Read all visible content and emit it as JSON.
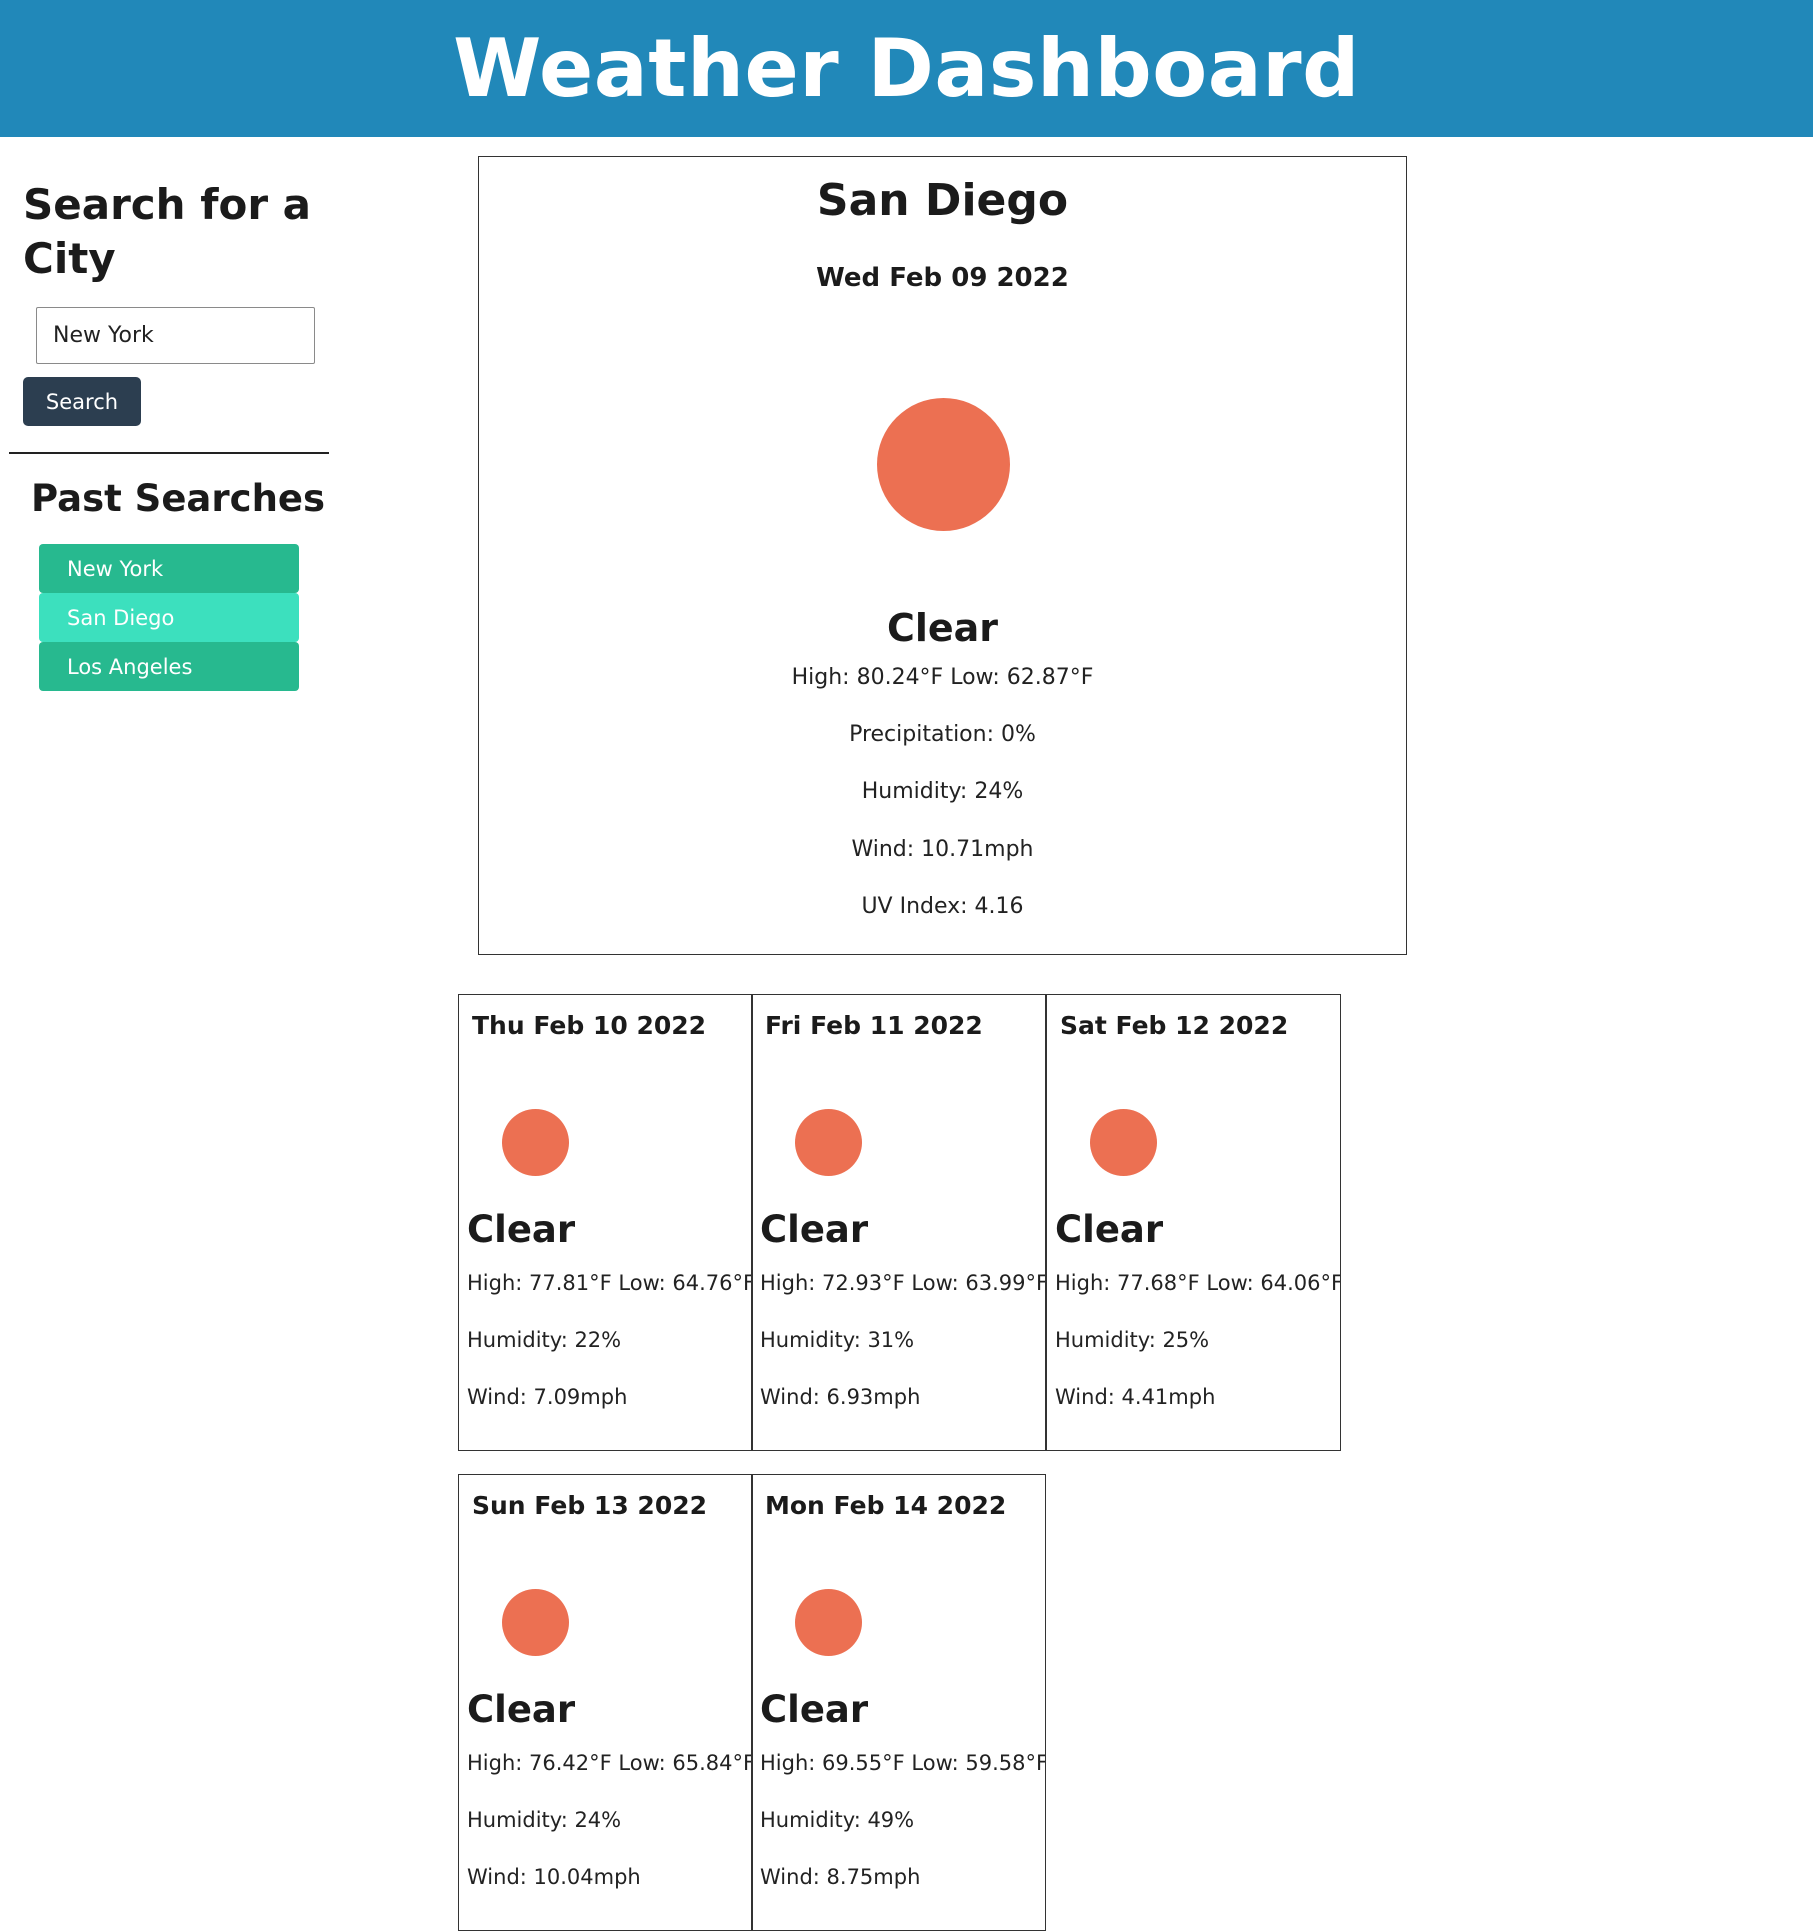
{
  "app": {
    "title": "Weather Dashboard"
  },
  "sidebar": {
    "search_title": "Search for a City",
    "search_input": {
      "value": "New York",
      "placeholder": ""
    },
    "search_button_label": "Search",
    "past_title": "Past Searches",
    "past_searches": [
      {
        "label": "New York",
        "color": "#27b98f"
      },
      {
        "label": "San Diego",
        "color": "#3ce0be"
      },
      {
        "label": "Los Angeles",
        "color": "#27b98f"
      }
    ]
  },
  "current": {
    "city": "San Diego",
    "date": "Wed Feb 09 2022",
    "icon": "sun-icon",
    "condition": "Clear",
    "high_low": "High: 80.24°F Low: 62.87°F",
    "precipitation": "Precipitation: 0%",
    "humidity": "Humidity: 24%",
    "wind": "Wind: 10.71mph",
    "uv_index": "UV Index: 4.16"
  },
  "forecast": [
    {
      "date": "Thu Feb 10 2022",
      "icon": "sun-icon",
      "condition": "Clear",
      "high_low": "High: 77.81°F Low: 64.76°F",
      "humidity": "Humidity: 22%",
      "wind": "Wind: 7.09mph"
    },
    {
      "date": "Fri Feb 11 2022",
      "icon": "sun-icon",
      "condition": "Clear",
      "high_low": "High: 72.93°F Low: 63.99°F",
      "humidity": "Humidity: 31%",
      "wind": "Wind: 6.93mph"
    },
    {
      "date": "Sat Feb 12 2022",
      "icon": "sun-icon",
      "condition": "Clear",
      "high_low": "High: 77.68°F Low: 64.06°F",
      "humidity": "Humidity: 25%",
      "wind": "Wind: 4.41mph"
    },
    {
      "date": "Sun Feb 13 2022",
      "icon": "sun-icon",
      "condition": "Clear",
      "high_low": "High: 76.42°F Low: 65.84°F",
      "humidity": "Humidity: 24%",
      "wind": "Wind: 10.04mph"
    },
    {
      "date": "Mon Feb 14 2022",
      "icon": "sun-icon",
      "condition": "Clear",
      "high_low": "High: 69.55°F Low: 59.58°F",
      "humidity": "Humidity: 49%",
      "wind": "Wind: 8.75mph"
    }
  ],
  "colors": {
    "header": "#2188b9",
    "search_button": "#2c3e50",
    "sun": "#ec7052"
  }
}
